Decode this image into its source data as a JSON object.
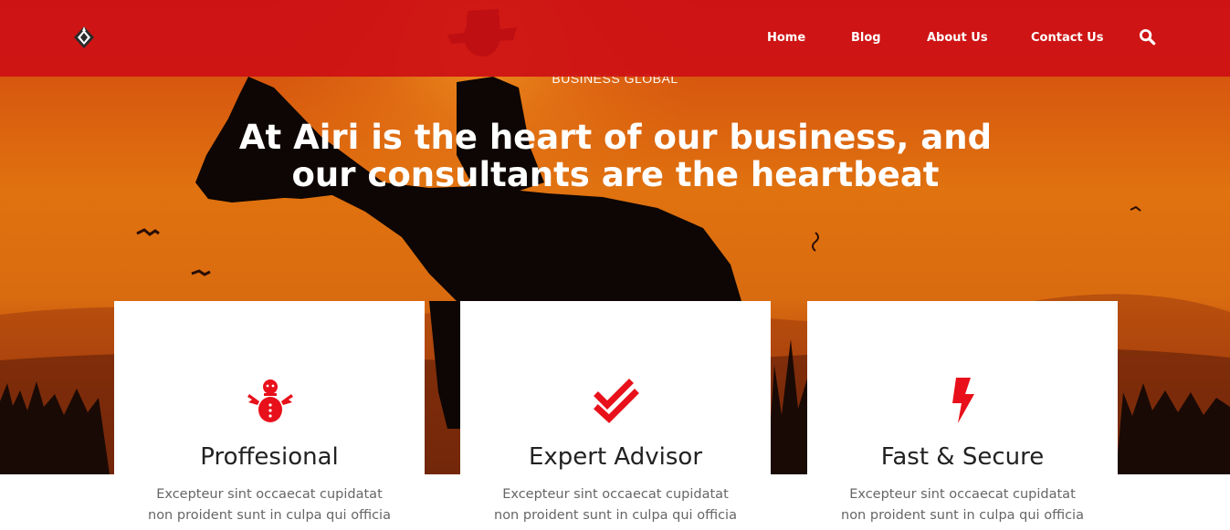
{
  "colors": {
    "brand_red": "#CE1014",
    "hero_orange": "#E0720F",
    "card_bg": "#FFFFFF",
    "icon_red": "#E8101A"
  },
  "header": {
    "logo_icon": "brand-logo-icon",
    "nav": [
      {
        "label": "Home"
      },
      {
        "label": "Blog"
      },
      {
        "label": "About Us"
      },
      {
        "label": "Contact Us"
      }
    ],
    "search_icon": "search-icon"
  },
  "hero": {
    "tagline": "BUSINESS GLOBAL",
    "headline_line1": "At Airi is the heart of our business, and",
    "headline_line2": "our consultants are the heartbeat"
  },
  "features": [
    {
      "icon": "snowman-icon",
      "title": "Proffesional",
      "desc_line1": "Excepteur sint occaecat cupidatat",
      "desc_line2": "non proident sunt in culpa qui officia"
    },
    {
      "icon": "double-check-icon",
      "title": "Expert Advisor",
      "desc_line1": "Excepteur sint occaecat cupidatat",
      "desc_line2": "non proident sunt in culpa qui officia"
    },
    {
      "icon": "lightning-bolt-icon",
      "title": "Fast & Secure",
      "desc_line1": "Excepteur sint occaecat cupidatat",
      "desc_line2": "non proident sunt in culpa qui officia"
    }
  ]
}
